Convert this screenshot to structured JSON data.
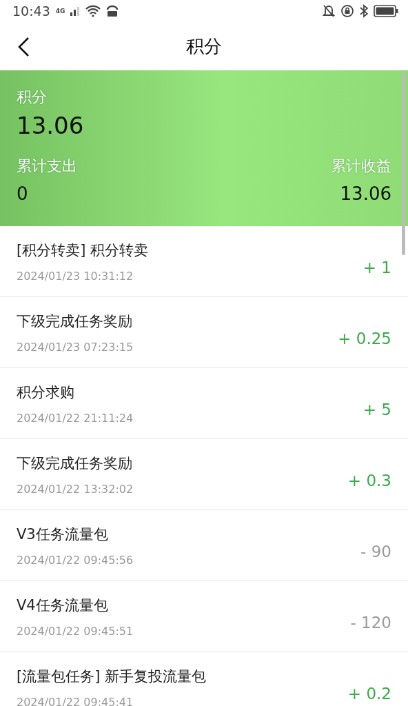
{
  "status_bar": {
    "time": "10:43",
    "network": "4G"
  },
  "header": {
    "title": "积分"
  },
  "summary": {
    "label": "积分",
    "value": "13.06",
    "spent_label": "累计支出",
    "spent": "0",
    "earned_label": "累计收益",
    "earned": "13.06"
  },
  "records": [
    {
      "title": "[积分转卖] 积分转卖",
      "time": "2024/01/23 10:31:12",
      "amount": "+ 1",
      "kind": "income"
    },
    {
      "title": "下级完成任务奖励",
      "time": "2024/01/23 07:23:15",
      "amount": "+ 0.25",
      "kind": "income"
    },
    {
      "title": "积分求购",
      "time": "2024/01/22 21:11:24",
      "amount": "+ 5",
      "kind": "income"
    },
    {
      "title": "下级完成任务奖励",
      "time": "2024/01/22 13:32:02",
      "amount": "+ 0.3",
      "kind": "income"
    },
    {
      "title": "V3任务流量包",
      "time": "2024/01/22 09:45:56",
      "amount": "- 90",
      "kind": "expense"
    },
    {
      "title": "V4任务流量包",
      "time": "2024/01/22 09:45:51",
      "amount": "- 120",
      "kind": "expense"
    },
    {
      "title": "[流量包任务] 新手复投流量包",
      "time": "2024/01/22 09:45:41",
      "amount": "+ 0.2",
      "kind": "income"
    }
  ]
}
